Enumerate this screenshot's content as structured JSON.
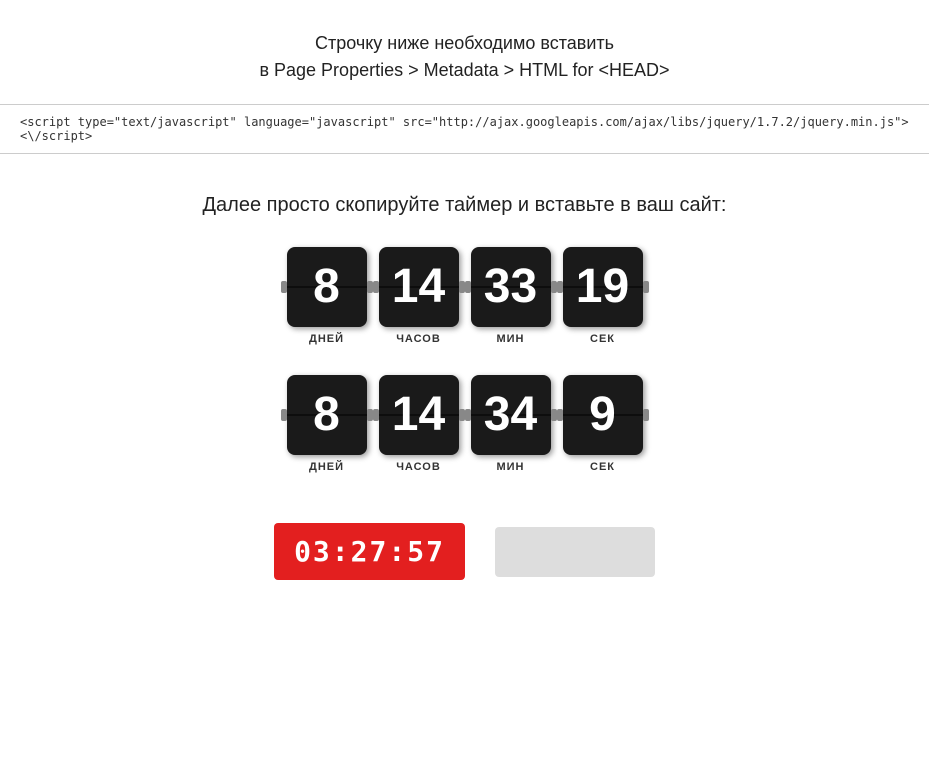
{
  "header": {
    "line1": "Строчку ниже необходимо вставить",
    "line2": "в Page Properties > Metadata > HTML for <HEAD>"
  },
  "code_snippet": "<script type=\"text/javascript\" language=\"javascript\" src=\"http://ajax.googleapis.com/ajax/libs/jquery/1.7.2/jquery.min.js\"><\\/script>",
  "copy_instruction": "Далее просто скопируйте таймер и вставьте в ваш сайт:",
  "timer1": {
    "days": {
      "value": "8",
      "label": "ДНЕЙ"
    },
    "hours": {
      "value": "14",
      "label": "ЧАСОВ"
    },
    "minutes": {
      "value": "33",
      "label": "МИН"
    },
    "seconds": {
      "value": "19",
      "label": "СЕК"
    }
  },
  "timer2": {
    "days": {
      "value": "8",
      "label": "ДНЕЙ"
    },
    "hours": {
      "value": "14",
      "label": "ЧАСОВ"
    },
    "minutes": {
      "value": "34",
      "label": "МИН"
    },
    "seconds": {
      "value": "9",
      "label": "СЕК"
    }
  },
  "clock": {
    "value": "03:27:57"
  }
}
